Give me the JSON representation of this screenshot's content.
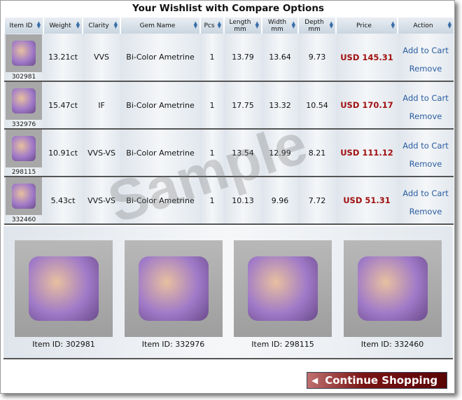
{
  "title": "Your Wishlist with Compare Options",
  "watermark": "Sample",
  "columns": [
    "Item ID",
    "Weight",
    "Clarity",
    "Gem Name",
    "Pcs",
    "Length mm",
    "Width mm",
    "Depth mm",
    "Price",
    "Action"
  ],
  "rows": [
    {
      "id": "302981",
      "weight": "13.21ct",
      "clarity": "VVS",
      "name": "Bi-Color Ametrine",
      "pcs": "1",
      "length": "13.79",
      "width": "13.64",
      "depth": "9.73",
      "price": "USD 145.31"
    },
    {
      "id": "332976",
      "weight": "15.47ct",
      "clarity": "IF",
      "name": "Bi-Color Ametrine",
      "pcs": "1",
      "length": "17.75",
      "width": "13.32",
      "depth": "10.54",
      "price": "USD 170.17"
    },
    {
      "id": "298115",
      "weight": "10.91ct",
      "clarity": "VVS-VS",
      "name": "Bi-Color Ametrine",
      "pcs": "1",
      "length": "13.54",
      "width": "12.99",
      "depth": "8.21",
      "price": "USD 111.12"
    },
    {
      "id": "332460",
      "weight": "5.43ct",
      "clarity": "VVS-VS",
      "name": "Bi-Color Ametrine",
      "pcs": "1",
      "length": "10.13",
      "width": "9.96",
      "depth": "7.72",
      "price": "USD 51.31"
    }
  ],
  "actions": {
    "add": "Add to Cart",
    "remove": "Remove"
  },
  "gallery": [
    "Item ID: 302981",
    "Item ID: 332976",
    "Item ID: 298115",
    "Item ID: 332460"
  ],
  "continue_label": "Continue Shopping",
  "colors": {
    "price": "#a01010",
    "link": "#2a5da0",
    "button": "#6a0a0a"
  }
}
